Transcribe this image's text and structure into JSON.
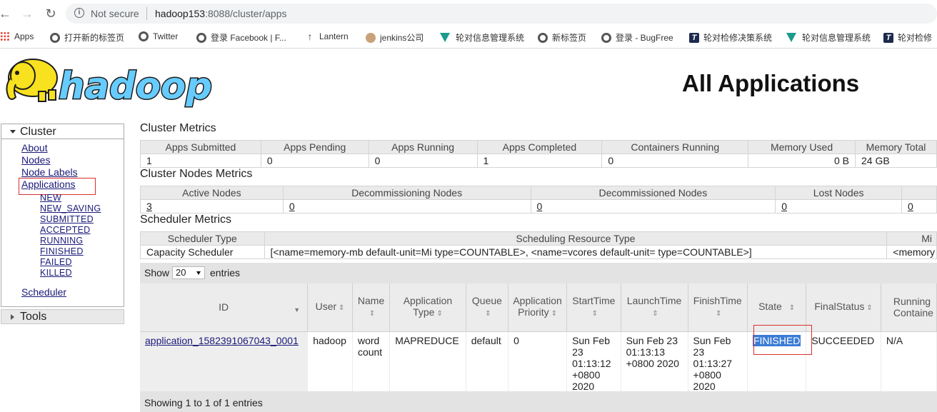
{
  "browser": {
    "secure_label": "Not secure",
    "url_host": "hadoop153",
    "url_rest": ":8088/cluster/apps"
  },
  "bookmarks": [
    {
      "label": "Apps",
      "icon": "apps-grid-icon"
    },
    {
      "label": "打开新的标签页",
      "icon": "globe-icon"
    },
    {
      "label": "Twitter",
      "icon": "globe-icon"
    },
    {
      "label": "登录 Facebook | F...",
      "icon": "globe-icon"
    },
    {
      "label": "Lantern",
      "icon": "up-arrow-icon"
    },
    {
      "label": "jenkins公司",
      "icon": "jenkins-icon"
    },
    {
      "label": "轮对信息管理系统",
      "icon": "vue-icon"
    },
    {
      "label": "新标签页",
      "icon": "globe-icon"
    },
    {
      "label": "登录 - BugFree",
      "icon": "globe-icon"
    },
    {
      "label": "轮对检修决策系统",
      "icon": "t-icon"
    },
    {
      "label": "轮对信息管理系统",
      "icon": "vue-icon"
    },
    {
      "label": "轮对检修",
      "icon": "t-icon"
    }
  ],
  "header": {
    "logo_text": "hadoop",
    "title": "All Applications"
  },
  "sidebar": {
    "cluster_label": "Cluster",
    "links": [
      "About",
      "Nodes",
      "Node Labels",
      "Applications"
    ],
    "states": [
      "NEW",
      "NEW_SAVING",
      "SUBMITTED",
      "ACCEPTED",
      "RUNNING",
      "FINISHED",
      "FAILED",
      "KILLED"
    ],
    "scheduler": "Scheduler",
    "tools_label": "Tools"
  },
  "cluster_metrics": {
    "title": "Cluster Metrics",
    "headers": [
      "Apps Submitted",
      "Apps Pending",
      "Apps Running",
      "Apps Completed",
      "Containers Running",
      "Memory Used",
      "Memory Total"
    ],
    "values": [
      "1",
      "0",
      "0",
      "1",
      "0",
      "0 B",
      "24 GB"
    ]
  },
  "nodes_metrics": {
    "title": "Cluster Nodes Metrics",
    "headers": [
      "Active Nodes",
      "Decommissioning Nodes",
      "Decommissioned Nodes",
      "Lost Nodes"
    ],
    "values": [
      "3",
      "0",
      "0",
      "0",
      "0"
    ]
  },
  "scheduler_metrics": {
    "title": "Scheduler Metrics",
    "headers": [
      "Scheduler Type",
      "Scheduling Resource Type",
      "Mi"
    ],
    "values": [
      "Capacity Scheduler",
      "[<name=memory-mb default-unit=Mi type=COUNTABLE>, <name=vcores default-unit= type=COUNTABLE>]",
      "<memory"
    ]
  },
  "apps": {
    "show_label": "Show",
    "page_size": "20",
    "entries_label": "entries",
    "headers": [
      {
        "l1": "ID",
        "l2": ""
      },
      {
        "l1": "User",
        "l2": ""
      },
      {
        "l1": "Name",
        "l2": ""
      },
      {
        "l1": "Application",
        "l2": "Type"
      },
      {
        "l1": "Queue",
        "l2": ""
      },
      {
        "l1": "Application",
        "l2": "Priority"
      },
      {
        "l1": "StartTime",
        "l2": ""
      },
      {
        "l1": "LaunchTime",
        "l2": ""
      },
      {
        "l1": "FinishTime",
        "l2": ""
      },
      {
        "l1": "State",
        "l2": ""
      },
      {
        "l1": "FinalStatus",
        "l2": ""
      },
      {
        "l1": "Running",
        "l2": "Containe"
      }
    ],
    "row": {
      "id": "application_1582391067043_0001",
      "user": "hadoop",
      "name_l1": "word",
      "name_l2": "count",
      "type": "MAPREDUCE",
      "queue": "default",
      "priority": "0",
      "start": [
        "Sun Feb",
        "23",
        "01:13:12",
        "+0800",
        "2020"
      ],
      "launch": [
        "Sun Feb 23",
        "01:13:13",
        "+0800 2020"
      ],
      "finish": [
        "Sun Feb",
        "23",
        "01:13:27",
        "+0800",
        "2020"
      ],
      "state": "FINISHED",
      "final_status": "SUCCEEDED",
      "running": "N/A"
    },
    "footer": "Showing 1 to 1 of 1 entries"
  },
  "colors": {
    "link": "#1a1a7a",
    "highlight_border": "#d9302c",
    "selection": "#3a7bd5",
    "logo_yellow": "#f8e11e",
    "logo_blue": "#66ccff"
  }
}
